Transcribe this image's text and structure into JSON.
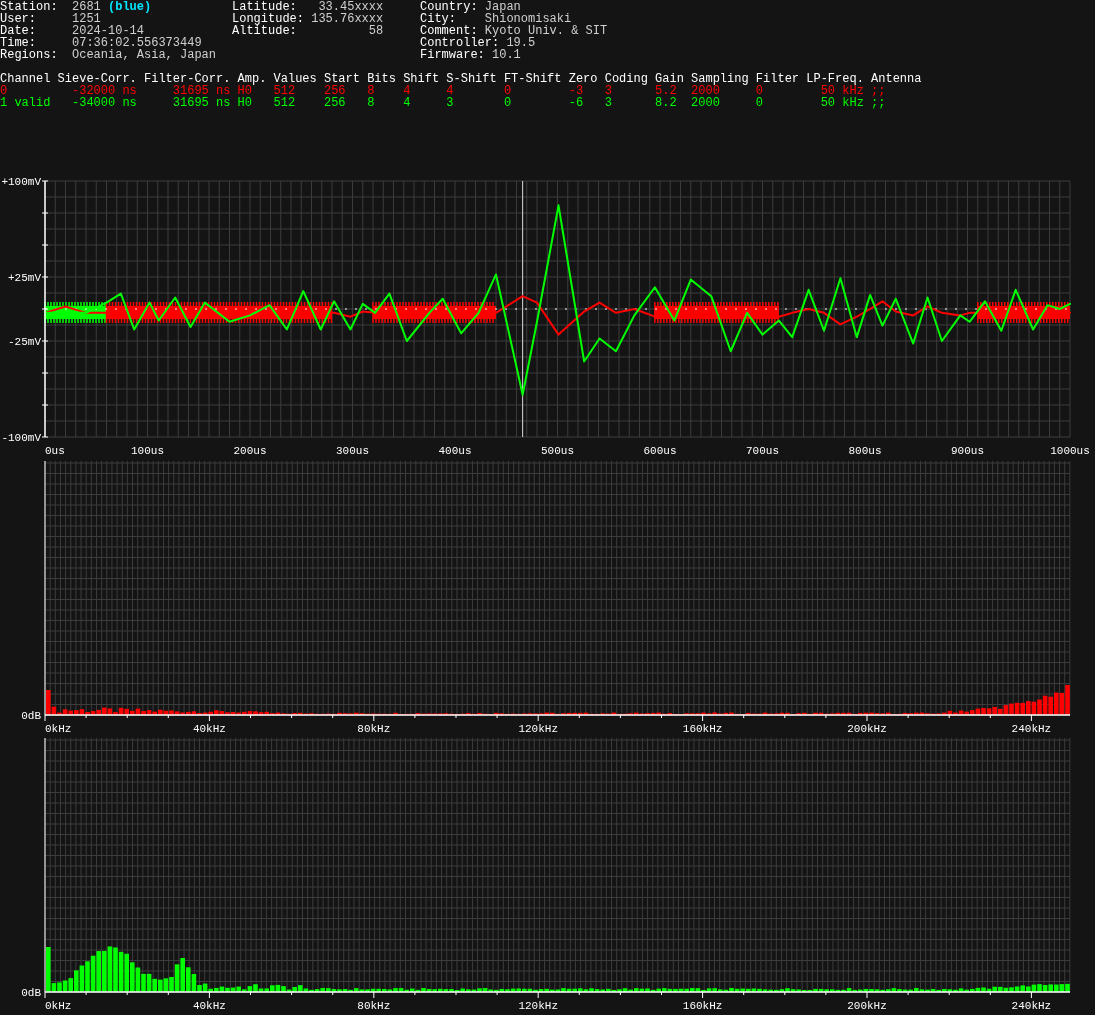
{
  "station_info": {
    "columns": [
      [
        {
          "label": "Station:",
          "value": "2681",
          "tag": "(blue)"
        },
        {
          "label": "User:",
          "value": "1251"
        },
        {
          "label": "Date:",
          "value": "2024-10-14"
        },
        {
          "label": "Time:",
          "value": "07:36:02.556373449"
        },
        {
          "label": "Regions:",
          "value": "Oceania, Asia, Japan"
        }
      ],
      [
        {
          "label": "Latitude:",
          "value": "33.45xxxx"
        },
        {
          "label": "Longitude:",
          "value": "135.76xxxx"
        },
        {
          "label": "Altitude:",
          "value": "58"
        }
      ],
      [
        {
          "label": "Country:",
          "value": "Japan"
        },
        {
          "label": "City:",
          "value": "Shionomisaki"
        },
        {
          "label": "Comment:",
          "value": "Kyoto Univ. & SIT"
        },
        {
          "label": "Controller:",
          "value": "19.5"
        },
        {
          "label": "Firmware:",
          "value": "10.1"
        }
      ]
    ]
  },
  "channel_table": {
    "columns": [
      "Channel",
      "Sieve-Corr.",
      "Filter-Corr.",
      "Amp.",
      "Values",
      "Start",
      "Bits",
      "Shift",
      "S-Shift",
      "FT-Shift",
      "Zero",
      "Coding",
      "Gain",
      "Sampling",
      "Filter",
      "LP-Freq.",
      "Antenna"
    ],
    "rows": [
      {
        "color": "#ff0000",
        "cells": [
          "0",
          "-32000 ns",
          "31695 ns",
          "H0",
          "512",
          "256",
          "8",
          "4",
          "4",
          "0",
          "-3",
          "3",
          "5.2",
          "2000",
          "0",
          "50 kHz",
          ";;"
        ]
      },
      {
        "color": "#00ff00",
        "cells": [
          "1 valid",
          "-34000 ns",
          "31695 ns",
          "H0",
          "512",
          "256",
          "8",
          "4",
          "3",
          "0",
          "-6",
          "3",
          "8.2",
          "2000",
          "0",
          "50 kHz",
          ";;"
        ]
      }
    ]
  },
  "waveform": {
    "chart_data": {
      "type": "line",
      "grid": true,
      "xlim": [
        0,
        1000
      ],
      "ylim": [
        -100,
        100
      ],
      "xticks": [
        {
          "value": 0,
          "label": "0us"
        },
        {
          "value": 100,
          "label": "100us"
        },
        {
          "value": 200,
          "label": "200us"
        },
        {
          "value": 300,
          "label": "300us"
        },
        {
          "value": 400,
          "label": "400us"
        },
        {
          "value": 500,
          "label": "500us"
        },
        {
          "value": 600,
          "label": "600us"
        },
        {
          "value": 700,
          "label": "700us"
        },
        {
          "value": 800,
          "label": "800us"
        },
        {
          "value": 900,
          "label": "900us"
        },
        {
          "value": 1000,
          "label": "1000us"
        }
      ],
      "yticks": [
        {
          "value": 100,
          "label": "+100mV"
        },
        {
          "value": 25,
          "label": "+25mV"
        },
        {
          "value": -25,
          "label": "-25mV"
        },
        {
          "value": -100,
          "label": "-100mV"
        }
      ],
      "x": [
        0,
        20,
        40,
        60,
        74,
        87,
        102,
        111,
        127,
        142,
        156,
        180,
        200,
        219,
        236,
        252,
        269,
        282,
        298,
        310,
        322,
        336,
        353,
        375,
        388,
        406,
        423,
        440,
        466,
        480,
        501,
        526,
        541,
        557,
        575,
        595,
        614,
        630,
        650,
        669,
        685,
        700,
        716,
        729,
        745,
        760,
        776,
        792,
        805,
        817,
        830,
        847,
        861,
        875,
        893,
        902,
        917,
        933,
        947,
        964,
        978,
        990,
        1000
      ],
      "series": [
        {
          "color": "#ff0000",
          "values": [
            -3,
            2,
            -3,
            -3,
            -3,
            -3,
            -3,
            -3,
            -3,
            -3,
            -3,
            -3,
            -3,
            -3,
            -3,
            -3,
            -3,
            -3,
            -6,
            -2,
            -3,
            -3,
            -3,
            -3,
            -3,
            -3,
            -3,
            -3,
            10,
            5,
            -20,
            -2,
            5,
            -3,
            0,
            -6,
            -3,
            -3,
            -3,
            -3,
            -3,
            -3,
            -6,
            -3,
            0,
            -3,
            -12,
            -6,
            0,
            6,
            -2,
            -5,
            2,
            -3,
            -5,
            -3,
            -3,
            -3,
            -3,
            -3,
            -3,
            -3,
            -3
          ]
        },
        {
          "color": "#00ff00",
          "values": [
            -3,
            -3,
            -3,
            5,
            12,
            -16,
            5,
            -9,
            9,
            -14,
            5,
            -10,
            -5,
            3,
            -16,
            14,
            -16,
            6,
            -16,
            4,
            -3,
            12,
            -25,
            -3,
            8,
            -19,
            -3,
            27,
            -67,
            -10,
            81,
            -41,
            -23,
            -33,
            -5,
            17,
            -9,
            23,
            10,
            -33,
            -3,
            -20,
            -9,
            -22,
            15,
            -17,
            24,
            -22,
            11,
            -13,
            8,
            -27,
            9,
            -25,
            -5,
            -10,
            6,
            -17,
            15,
            -16,
            3,
            0,
            4
          ]
        }
      ]
    }
  },
  "spectra": [
    {
      "color": "#ff0000",
      "y_label": "0dB",
      "x_labels": [
        "0kHz",
        "40kHz",
        "80kHz",
        "120kHz",
        "160kHz",
        "200kHz",
        "240kHz"
      ]
    },
    {
      "color": "#00ff00",
      "y_label": "0dB",
      "x_labels": [
        "0kHz",
        "40kHz",
        "80kHz",
        "120kHz",
        "160kHz",
        "200kHz",
        "240kHz"
      ]
    }
  ]
}
